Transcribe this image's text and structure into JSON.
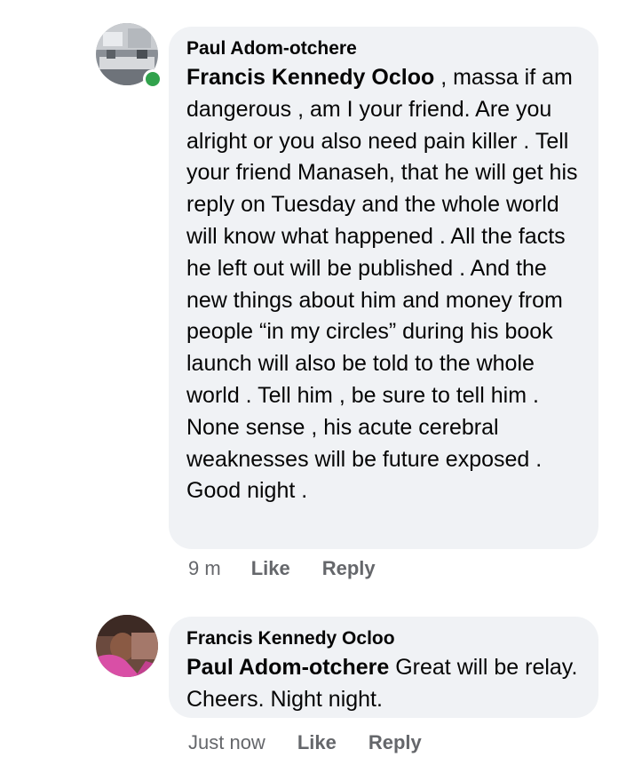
{
  "comments": [
    {
      "author": "Paul Adom-otchere",
      "mention": "Francis Kennedy Ocloo",
      "text": " , massa if am dangerous , am I your friend. Are you alright or you also need pain killer . Tell your friend Manaseh, that he will get his reply on Tuesday and the whole world will know what happened . All the facts he left out will be published . And the new things about him and money from people “in my circles” during his book launch will also be told to the whole world . Tell him , be sure to tell him . None sense , his acute cerebral weaknesses will be future exposed . Good night .",
      "time": "9 m",
      "like_label": "Like",
      "reply_label": "Reply",
      "online": true
    },
    {
      "author": "Francis Kennedy Ocloo",
      "mention": "Paul Adom-otchere",
      "text": " Great will be relay. Cheers. Night night.",
      "time": "Just now",
      "like_label": "Like",
      "reply_label": "Reply",
      "online": false
    }
  ],
  "colors": {
    "bubble": "#f0f2f5",
    "text": "#050505",
    "meta": "#65676b",
    "online": "#31a24c"
  }
}
